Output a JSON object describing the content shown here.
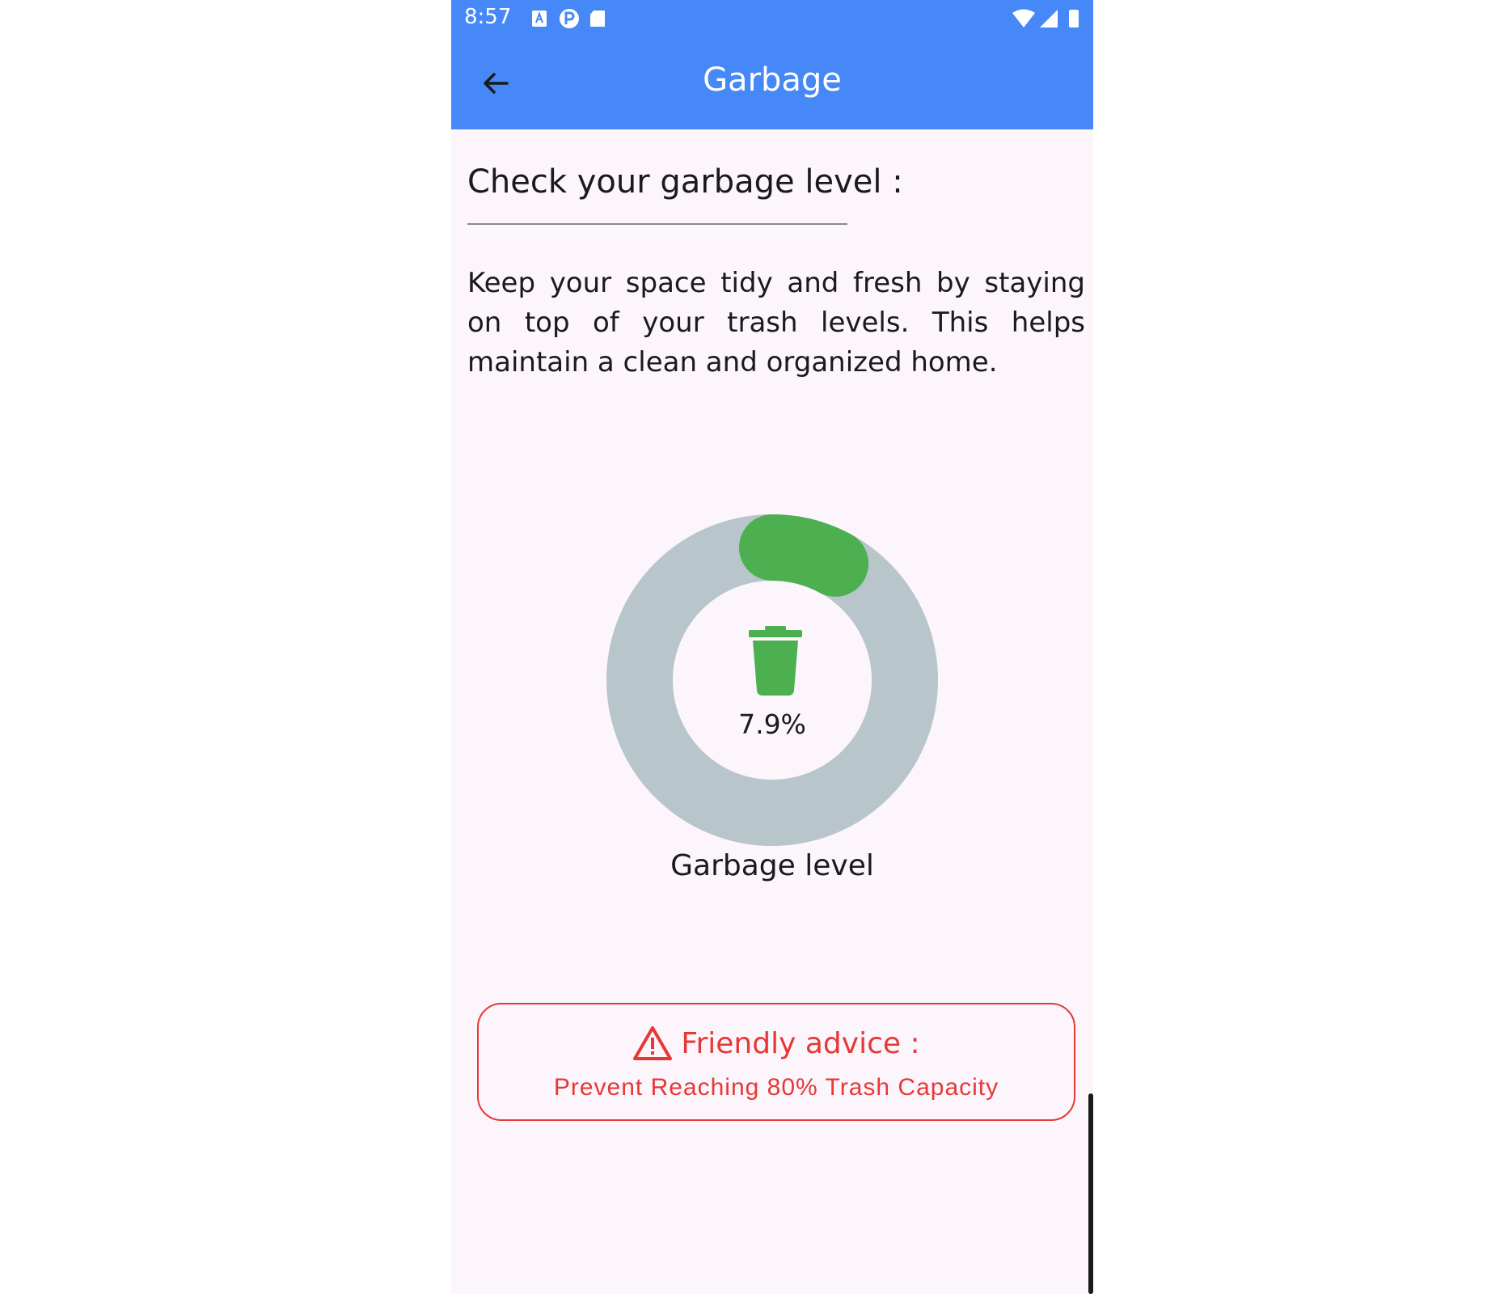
{
  "status_bar": {
    "time": "8:57",
    "left_icons": [
      "notification-a-icon",
      "parking-icon",
      "sd-card-icon"
    ],
    "right_icons": [
      "wifi-icon",
      "signal-icon",
      "battery-icon"
    ]
  },
  "app_bar": {
    "title": "Garbage",
    "back_icon": "arrow-back-icon"
  },
  "main": {
    "section_title": "Check your garbage level :",
    "description": "Keep your space tidy and fresh by staying on top of your trash levels. This helps maintain a clean and organized home."
  },
  "gauge": {
    "value": 7.9,
    "value_text": "7.9%",
    "label": "Garbage level",
    "icon": "trash-can-icon",
    "track_color": "#b8c6cc",
    "progress_color": "#4caf50"
  },
  "advice": {
    "icon": "warning-triangle-icon",
    "title": "Friendly advice :",
    "text": "Prevent Reaching 80% Trash Capacity",
    "color": "#e53935"
  },
  "colors": {
    "app_bar": "#4688f7",
    "background": "#fcf5fc"
  }
}
